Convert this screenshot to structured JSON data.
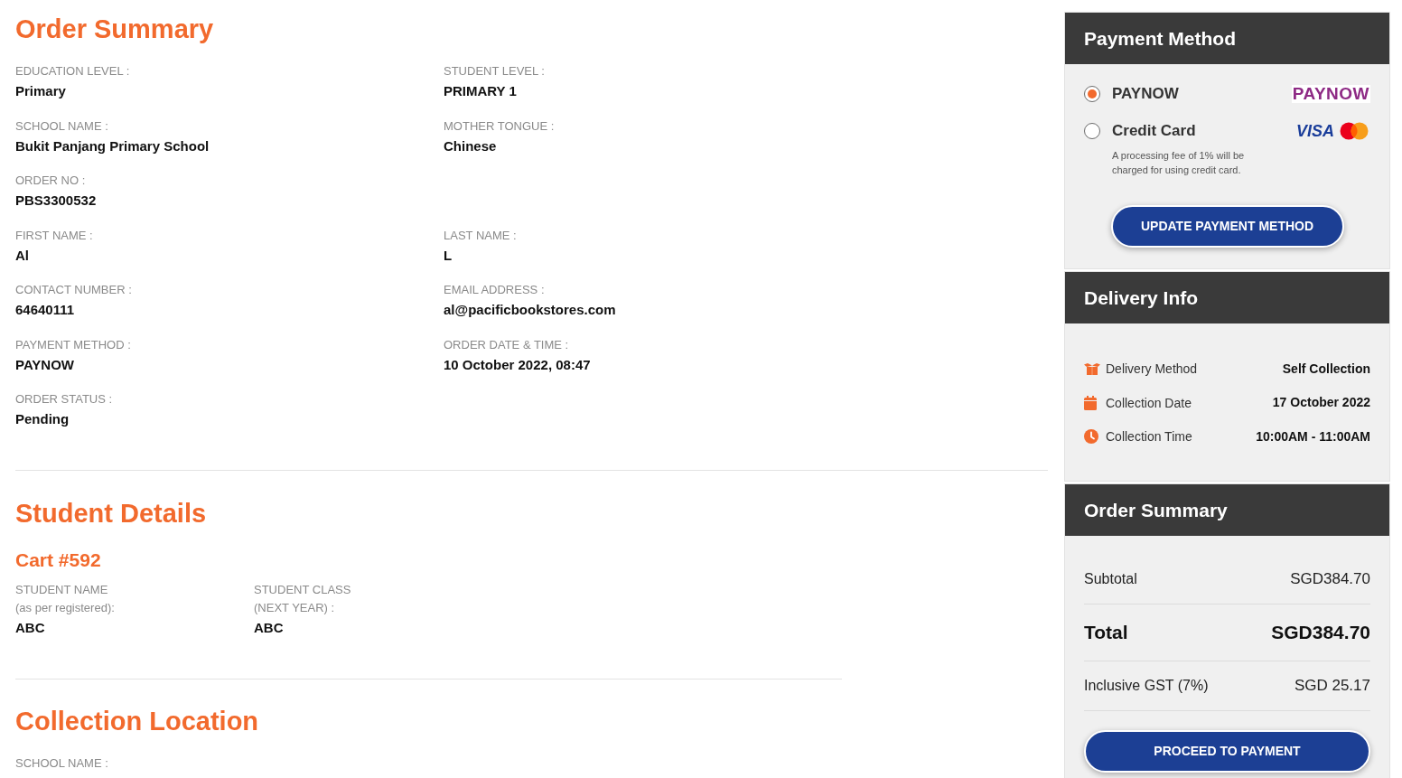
{
  "order_summary": {
    "title": "Order Summary",
    "rows": [
      [
        {
          "label": "EDUCATION LEVEL :",
          "value": "Primary"
        },
        {
          "label": "STUDENT LEVEL :",
          "value": "PRIMARY 1"
        }
      ],
      [
        {
          "label": "SCHOOL NAME :",
          "value": "Bukit Panjang Primary School"
        },
        {
          "label": "MOTHER TONGUE :",
          "value": "Chinese"
        }
      ],
      [
        {
          "label": "ORDER NO :",
          "value": "PBS3300532"
        }
      ],
      [
        {
          "label": "FIRST NAME :",
          "value": "Al"
        },
        {
          "label": "LAST NAME :",
          "value": "L"
        }
      ],
      [
        {
          "label": "CONTACT NUMBER :",
          "value": "64640111"
        },
        {
          "label": "EMAIL ADDRESS :",
          "value": "al@pacificbookstores.com"
        }
      ],
      [
        {
          "label": "PAYMENT METHOD :",
          "value": "PAYNOW"
        },
        {
          "label": "ORDER DATE & TIME :",
          "value": "10 October 2022, 08:47"
        }
      ],
      [
        {
          "label": "ORDER STATUS :",
          "value": "Pending"
        }
      ]
    ]
  },
  "student_details": {
    "title": "Student Details",
    "cart": "Cart #592",
    "fields": [
      {
        "label_lines": [
          "STUDENT NAME",
          "(as per registered):"
        ],
        "value": "ABC"
      },
      {
        "label_lines": [
          "STUDENT CLASS",
          "(NEXT YEAR) :"
        ],
        "value": "ABC"
      }
    ]
  },
  "collection_location": {
    "title": "Collection Location",
    "fields": [
      {
        "label": "SCHOOL NAME :"
      }
    ]
  },
  "payment_method": {
    "title": "Payment Method",
    "options": [
      {
        "kind": "paynow",
        "label": "PAYNOW",
        "selected": true,
        "logo": "PAYNOW"
      },
      {
        "kind": "card",
        "label": "Credit Card",
        "selected": false,
        "logo": "VISA",
        "note": "A processing fee of 1% will be charged for using credit card."
      }
    ],
    "button": "UPDATE PAYMENT METHOD"
  },
  "delivery_info": {
    "title": "Delivery Info",
    "rows": [
      {
        "kind": "method",
        "label": "Delivery Method",
        "value": "Self Collection"
      },
      {
        "kind": "date",
        "label": "Collection Date",
        "value": "17 October 2022"
      },
      {
        "kind": "time",
        "label": "Collection Time",
        "value": "10:00AM - 11:00AM"
      }
    ]
  },
  "order_totals": {
    "title": "Order Summary",
    "rows": [
      {
        "kind": "line",
        "label": "Subtotal",
        "value": "SGD384.70"
      },
      {
        "kind": "total",
        "label": "Total",
        "value": "SGD384.70"
      },
      {
        "kind": "line",
        "label": "Inclusive GST (7%)",
        "value": "SGD 25.17"
      }
    ],
    "button": "PROCEED TO PAYMENT"
  }
}
